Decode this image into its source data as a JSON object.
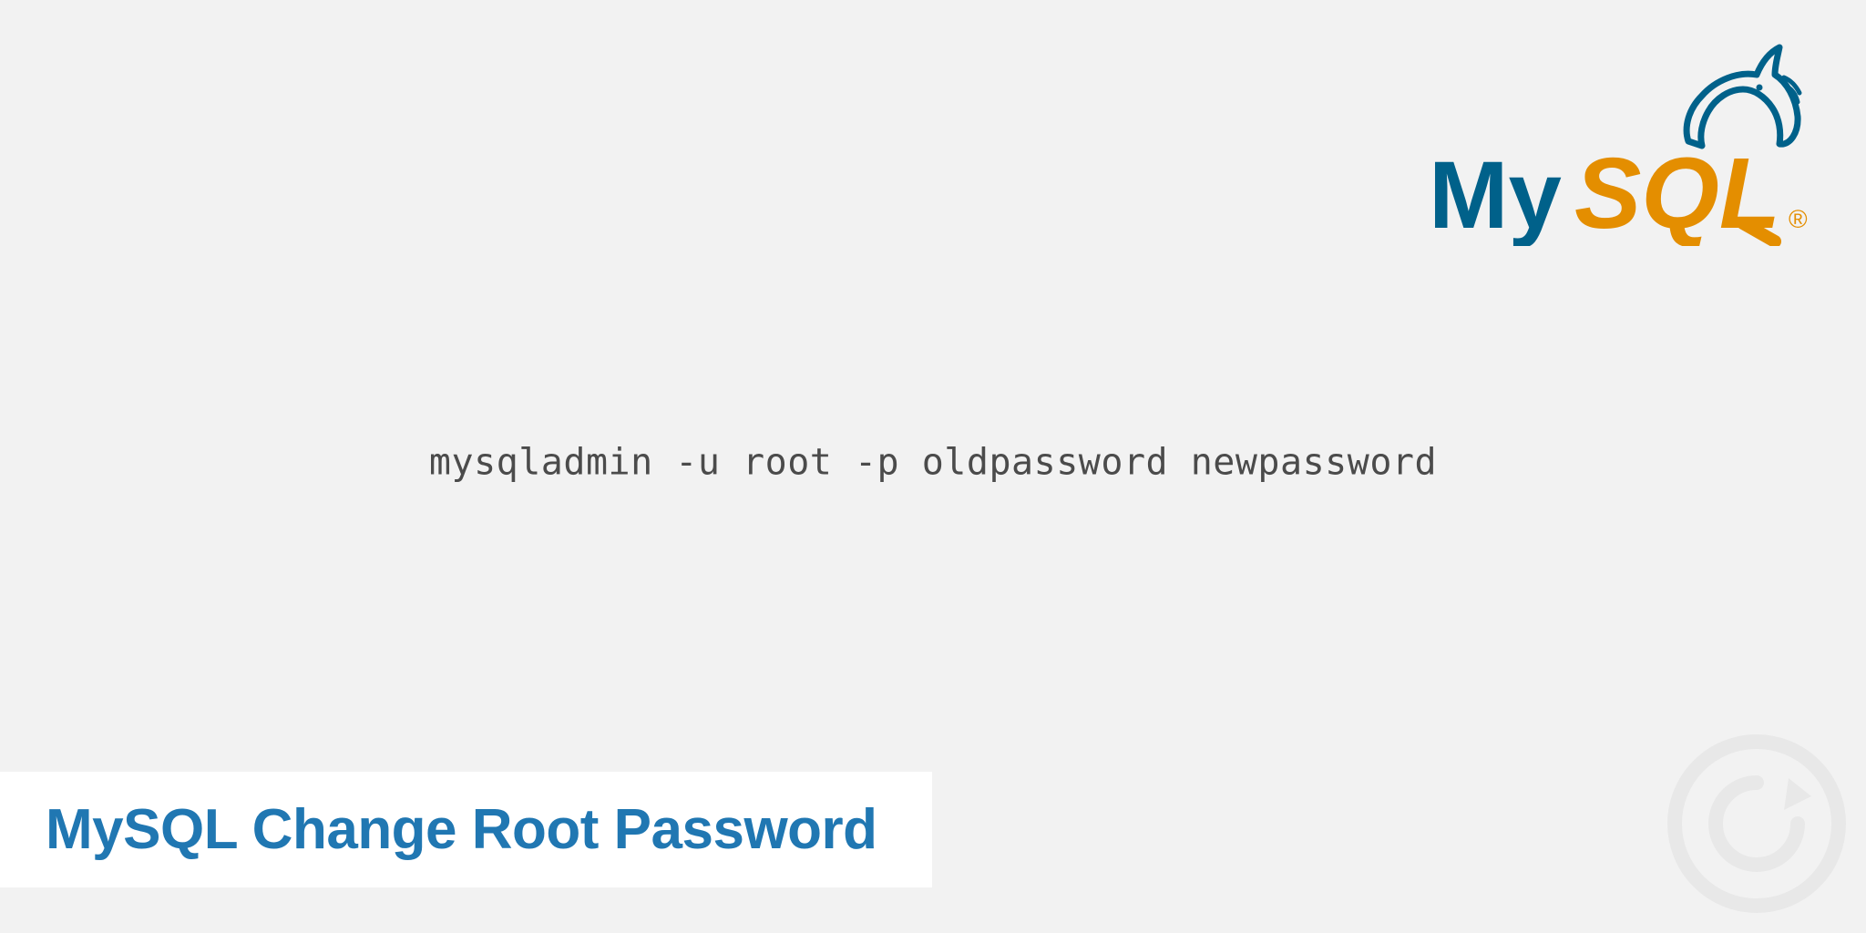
{
  "logo": {
    "name": "mysql-logo",
    "text_my": "My",
    "text_sql": "SQL",
    "trademark": "®",
    "colors": {
      "blue": "#00618a",
      "orange": "#e48e00"
    }
  },
  "command": "mysqladmin -u root -p oldpassword newpassword",
  "title": "MySQL Change Root Password"
}
